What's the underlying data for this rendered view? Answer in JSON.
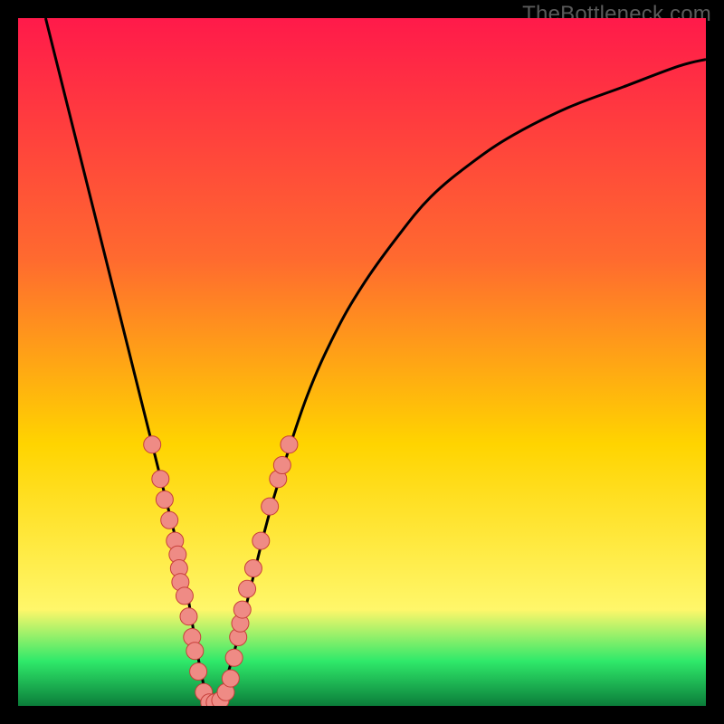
{
  "watermark": "TheBottleneck.com",
  "colors": {
    "frame": "#000000",
    "grad_top": "#ff1a4a",
    "grad_mid1": "#ff6a2f",
    "grad_mid2": "#ffd400",
    "grad_mid3": "#fff76a",
    "grad_bottom_band": "#2fe96a",
    "grad_bottom": "#0b7d3a",
    "curve": "#000000",
    "dot_fill": "#ef8b85",
    "dot_stroke": "#c73f3a"
  },
  "chart_data": {
    "type": "line",
    "title": "",
    "xlabel": "",
    "ylabel": "",
    "xlim": [
      0,
      100
    ],
    "ylim": [
      0,
      100
    ],
    "series": [
      {
        "name": "bottleneck-curve",
        "x": [
          4,
          6,
          8,
          10,
          12,
          14,
          16,
          18,
          20,
          22,
          23,
          24,
          25,
          26,
          27,
          28,
          29,
          30,
          32,
          34,
          36,
          38,
          42,
          46,
          50,
          55,
          60,
          66,
          72,
          80,
          88,
          96,
          100
        ],
        "y": [
          100,
          92,
          84,
          76,
          68,
          60,
          52,
          44,
          36,
          28,
          24,
          20,
          14,
          8,
          3,
          0,
          0,
          3,
          10,
          18,
          26,
          33,
          45,
          54,
          61,
          68,
          74,
          79,
          83,
          87,
          90,
          93,
          94
        ]
      }
    ],
    "dots": {
      "name": "highlight-points",
      "points": [
        {
          "x": 19.5,
          "y": 38
        },
        {
          "x": 20.7,
          "y": 33
        },
        {
          "x": 21.3,
          "y": 30
        },
        {
          "x": 22.0,
          "y": 27
        },
        {
          "x": 22.8,
          "y": 24
        },
        {
          "x": 23.2,
          "y": 22
        },
        {
          "x": 23.4,
          "y": 20
        },
        {
          "x": 23.6,
          "y": 18
        },
        {
          "x": 24.2,
          "y": 16
        },
        {
          "x": 24.8,
          "y": 13
        },
        {
          "x": 25.3,
          "y": 10
        },
        {
          "x": 25.7,
          "y": 8
        },
        {
          "x": 26.2,
          "y": 5
        },
        {
          "x": 27.0,
          "y": 2
        },
        {
          "x": 27.8,
          "y": 0.5
        },
        {
          "x": 28.6,
          "y": 0.5
        },
        {
          "x": 29.4,
          "y": 0.8
        },
        {
          "x": 30.2,
          "y": 2
        },
        {
          "x": 30.9,
          "y": 4
        },
        {
          "x": 31.4,
          "y": 7
        },
        {
          "x": 32.0,
          "y": 10
        },
        {
          "x": 32.3,
          "y": 12
        },
        {
          "x": 32.6,
          "y": 14
        },
        {
          "x": 33.3,
          "y": 17
        },
        {
          "x": 34.2,
          "y": 20
        },
        {
          "x": 35.3,
          "y": 24
        },
        {
          "x": 36.6,
          "y": 29
        },
        {
          "x": 37.8,
          "y": 33
        },
        {
          "x": 38.4,
          "y": 35
        },
        {
          "x": 39.4,
          "y": 38
        }
      ]
    },
    "gradient_stops": [
      {
        "offset": 0.0,
        "color_key": "grad_top"
      },
      {
        "offset": 0.35,
        "color_key": "grad_mid1"
      },
      {
        "offset": 0.62,
        "color_key": "grad_mid2"
      },
      {
        "offset": 0.86,
        "color_key": "grad_mid3"
      },
      {
        "offset": 0.935,
        "color_key": "grad_bottom_band"
      },
      {
        "offset": 1.0,
        "color_key": "grad_bottom"
      }
    ]
  }
}
